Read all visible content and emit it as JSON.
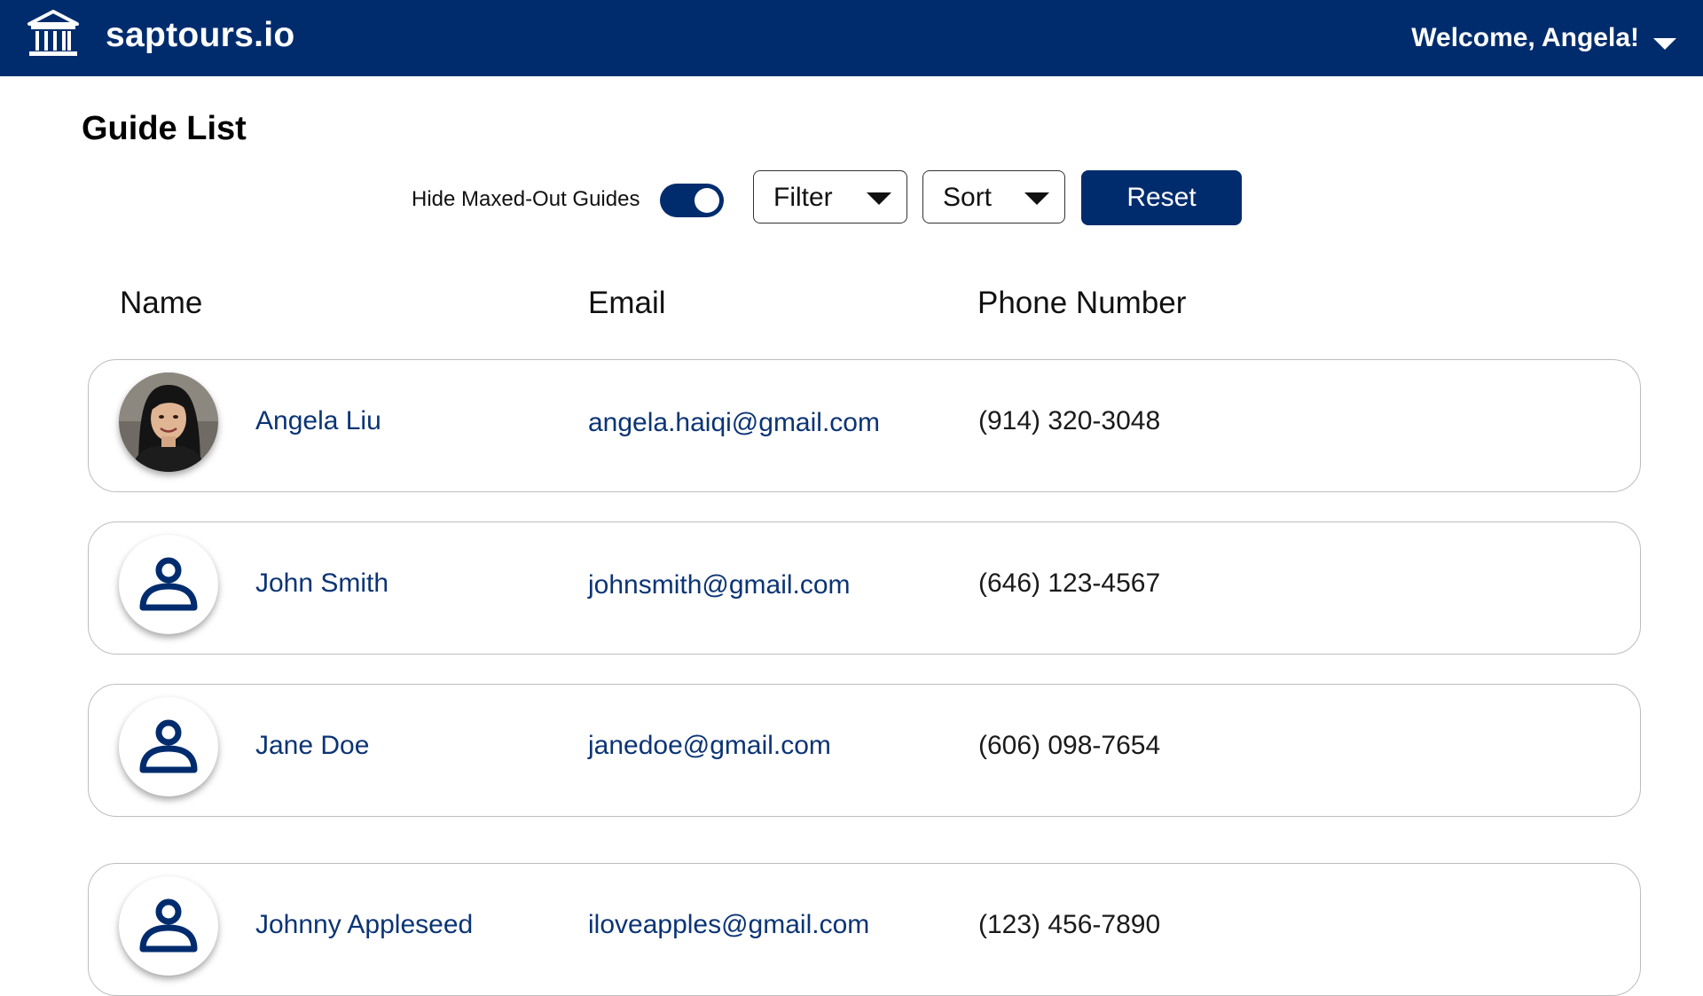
{
  "header": {
    "brand": "saptours.io",
    "welcome": "Welcome, Angela!",
    "logo_icon": "museum-building-icon",
    "menu_icon": "caret-down-icon"
  },
  "page": {
    "title": "Guide List"
  },
  "controls": {
    "toggle_label": "Hide Maxed-Out Guides",
    "toggle_on": true,
    "filter_label": "Filter",
    "sort_label": "Sort",
    "reset_label": "Reset"
  },
  "table": {
    "columns": [
      "Name",
      "Email",
      "Phone Number"
    ],
    "rows": [
      {
        "name": "Angela Liu",
        "email": "angela.haiqi@gmail.com",
        "phone": "(914) 320-3048",
        "avatar": "photo"
      },
      {
        "name": "John Smith",
        "email": "johnsmith@gmail.com",
        "phone": "(646) 123-4567",
        "avatar": "user-icon"
      },
      {
        "name": "Jane Doe",
        "email": "janedoe@gmail.com",
        "phone": "(606) 098-7654",
        "avatar": "user-icon"
      },
      {
        "name": "Johnny Appleseed",
        "email": "iloveapples@gmail.com",
        "phone": "(123) 456-7890",
        "avatar": "user-icon"
      }
    ]
  },
  "colors": {
    "primary": "#002c6e",
    "link": "#0b3475",
    "row_border": "#bdbdbd"
  }
}
